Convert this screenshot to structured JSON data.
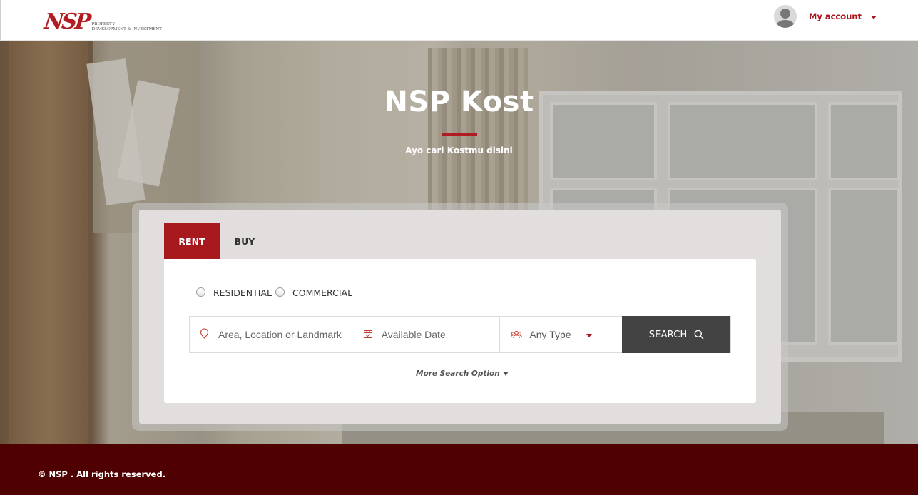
{
  "header": {
    "logo_mark": "NSP",
    "logo_line1": "Property",
    "logo_line2": "Development & Investment",
    "account_label": "My account"
  },
  "hero": {
    "title": "NSP Kost",
    "subtitle": "Ayo cari Kostmu disini"
  },
  "search": {
    "tabs": [
      "RENT",
      "BUY"
    ],
    "active_tab": "RENT",
    "property_types": [
      "RESIDENTIAL",
      "COMMERCIAL"
    ],
    "location_placeholder": "Area, Location or Landmark",
    "date_placeholder": "Available Date",
    "type_value": "Any Type",
    "button_label": "SEARCH",
    "more_option": "More Search Option"
  },
  "footer": {
    "copyright": "© NSP . All rights reserved."
  },
  "colors": {
    "brand_red": "#a8191e",
    "footer_bg": "#4f0000",
    "search_button": "#434343"
  }
}
